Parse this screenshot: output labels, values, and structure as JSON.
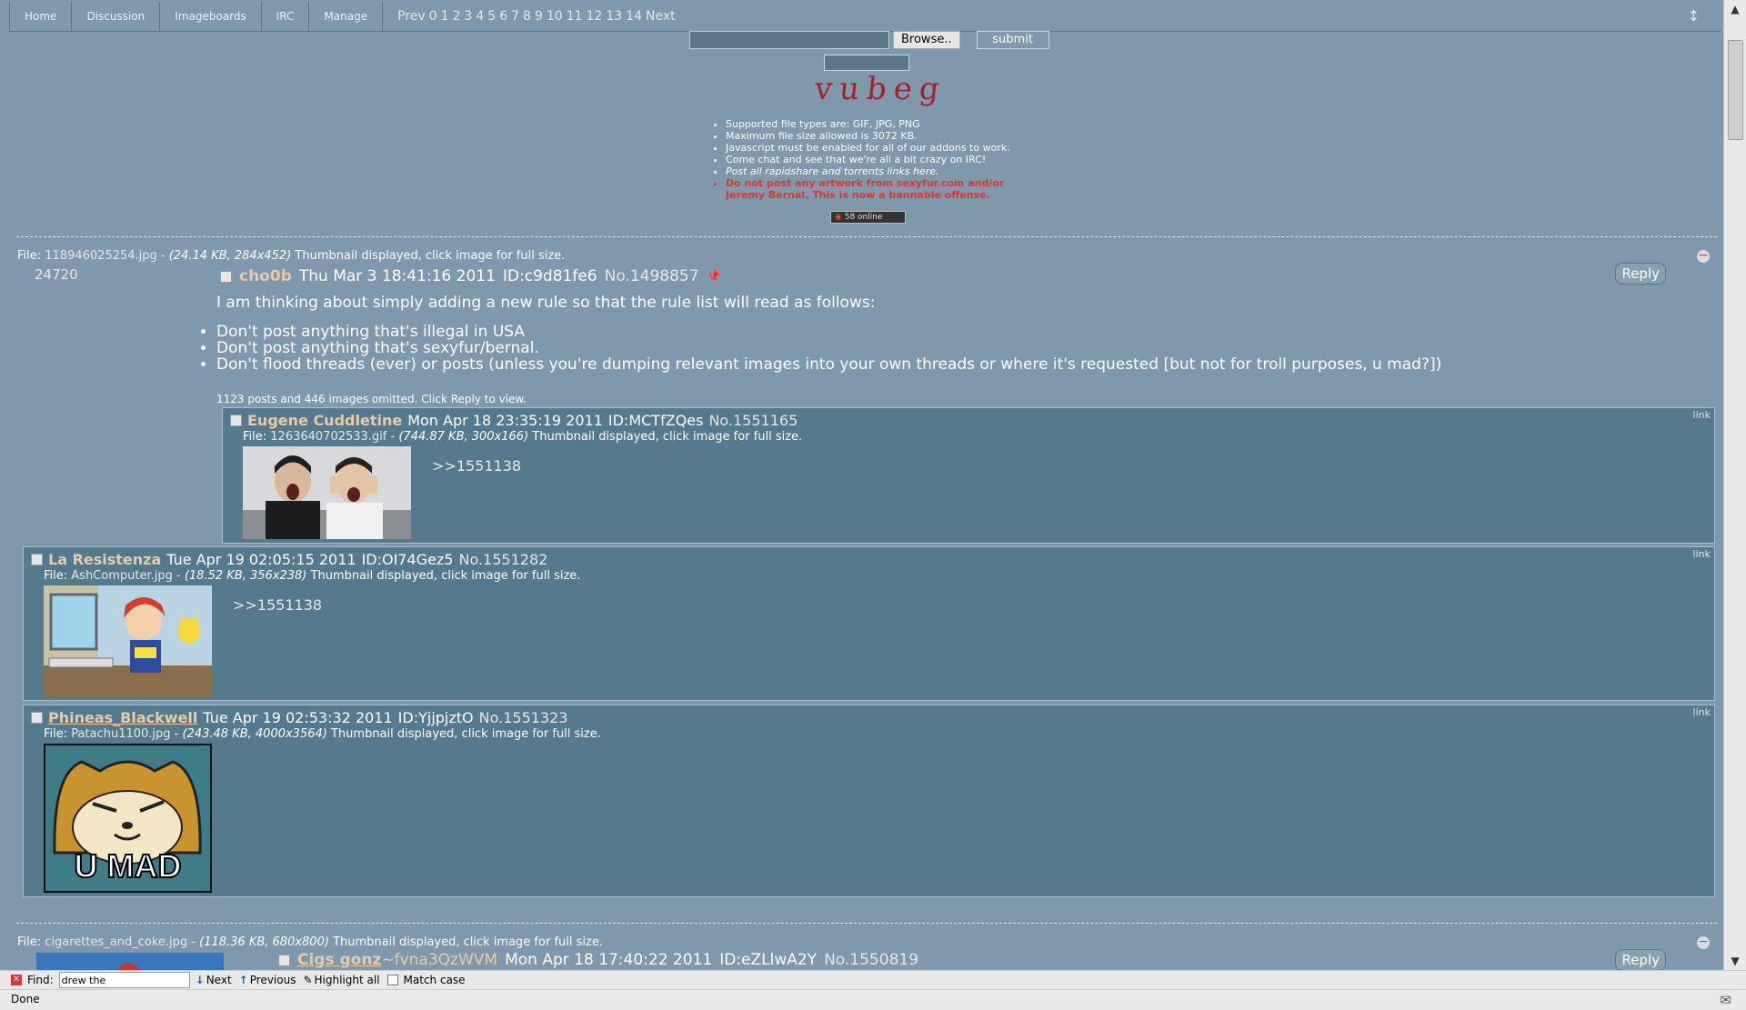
{
  "nav": {
    "tabs": [
      "Home",
      "Discussion",
      "Imageboards",
      "IRC",
      "Manage"
    ],
    "prev": "Prev",
    "pages": [
      "0",
      "1",
      "2",
      "3",
      "4",
      "5",
      "6",
      "7",
      "8",
      "9",
      "10",
      "11",
      "12",
      "13",
      "14"
    ],
    "next": "Next"
  },
  "form": {
    "browse_label": "Browse..",
    "submit_label": "submit"
  },
  "logo_text": "vubeg",
  "rules": {
    "items": [
      "Supported file types are: GIF, JPG, PNG",
      "Maximum file size allowed is 3072 KB.",
      "Javascript must be enabled for all of our addons to work.",
      "Come chat and see that we're all a bit crazy on IRC!",
      "Post all rapidshare and torrents links here."
    ],
    "warning_line1": "Do not post any artwork from sexyfur.com and/or",
    "warning_line2": "Jeremy Bernal. This is now a bannable offense."
  },
  "online_badge": "58 online",
  "thread1": {
    "file_label": "File:",
    "file_name": "118946025254.jpg",
    "file_info": "(24.14 KB, 284x452)",
    "file_note": "Thumbnail displayed, click image for full size.",
    "post_count": "24720",
    "name": "cho0b",
    "date": "Thu Mar 3 18:41:16 2011",
    "id": "ID:c9d81fe6",
    "number": "No.1498857",
    "reply_label": "Reply",
    "body_intro": "I am thinking about simply adding a new rule so that the rule list will read as follows:",
    "body_rules": [
      "Don't post anything that's illegal in USA",
      "Don't post anything that's sexyfur/bernal.",
      "Don't flood threads (ever) or posts (unless you're dumping relevant images into your own threads or where it's requested [but not for troll purposes, u mad?])"
    ],
    "omitted": "1123 posts and 446 images omitted. Click Reply to view.",
    "replies": [
      {
        "name": "Eugene Cuddletine",
        "date": "Mon Apr 18 23:35:19 2011",
        "id": "ID:MCTfZQes",
        "number": "No.1551165",
        "file_name": "1263640702533.gif",
        "file_info": "(744.87 KB, 300x166)",
        "quote": ">>1551138",
        "link": "link"
      },
      {
        "name": "La Resistenza",
        "date": "Tue Apr 19 02:05:15 2011",
        "id": "ID:OI74Gez5",
        "number": "No.1551282",
        "file_name": "AshComputer.jpg",
        "file_info": "(18.52 KB, 356x238)",
        "quote": ">>1551138",
        "link": "link"
      },
      {
        "name": "Phineas_Blackwell",
        "date": "Tue Apr 19 02:53:32 2011",
        "id": "ID:YjjpjztO",
        "number": "No.1551323",
        "file_name": "Patachu1100.jpg",
        "file_info": "(243.48 KB, 4000x3564)",
        "image_caption": "U MAD",
        "link": "link"
      }
    ]
  },
  "thread2": {
    "file_label": "File:",
    "file_name": "cigarettes_and_coke.jpg",
    "file_info": "(118.36 KB, 680x800)",
    "file_note": "Thumbnail displayed, click image for full size.",
    "name": "Cigs gonz",
    "tripcode": "~fvna3QzWVM",
    "date": "Mon Apr 18 17:40:22 2011",
    "id": "ID:eZLlwA2Y",
    "number": "No.1550819",
    "reply_label": "Reply"
  },
  "findbar": {
    "label": "Find:",
    "value": "drew the",
    "next": "Next",
    "previous": "Previous",
    "highlight": "Highlight all",
    "match_case": "Match case"
  },
  "status": "Done",
  "colors": {
    "page_bg": "#7f98ab",
    "reply_bg": "#567a8d",
    "name": "#e8c9a8",
    "warning": "#d53a3a",
    "logo": "#a8202a"
  }
}
